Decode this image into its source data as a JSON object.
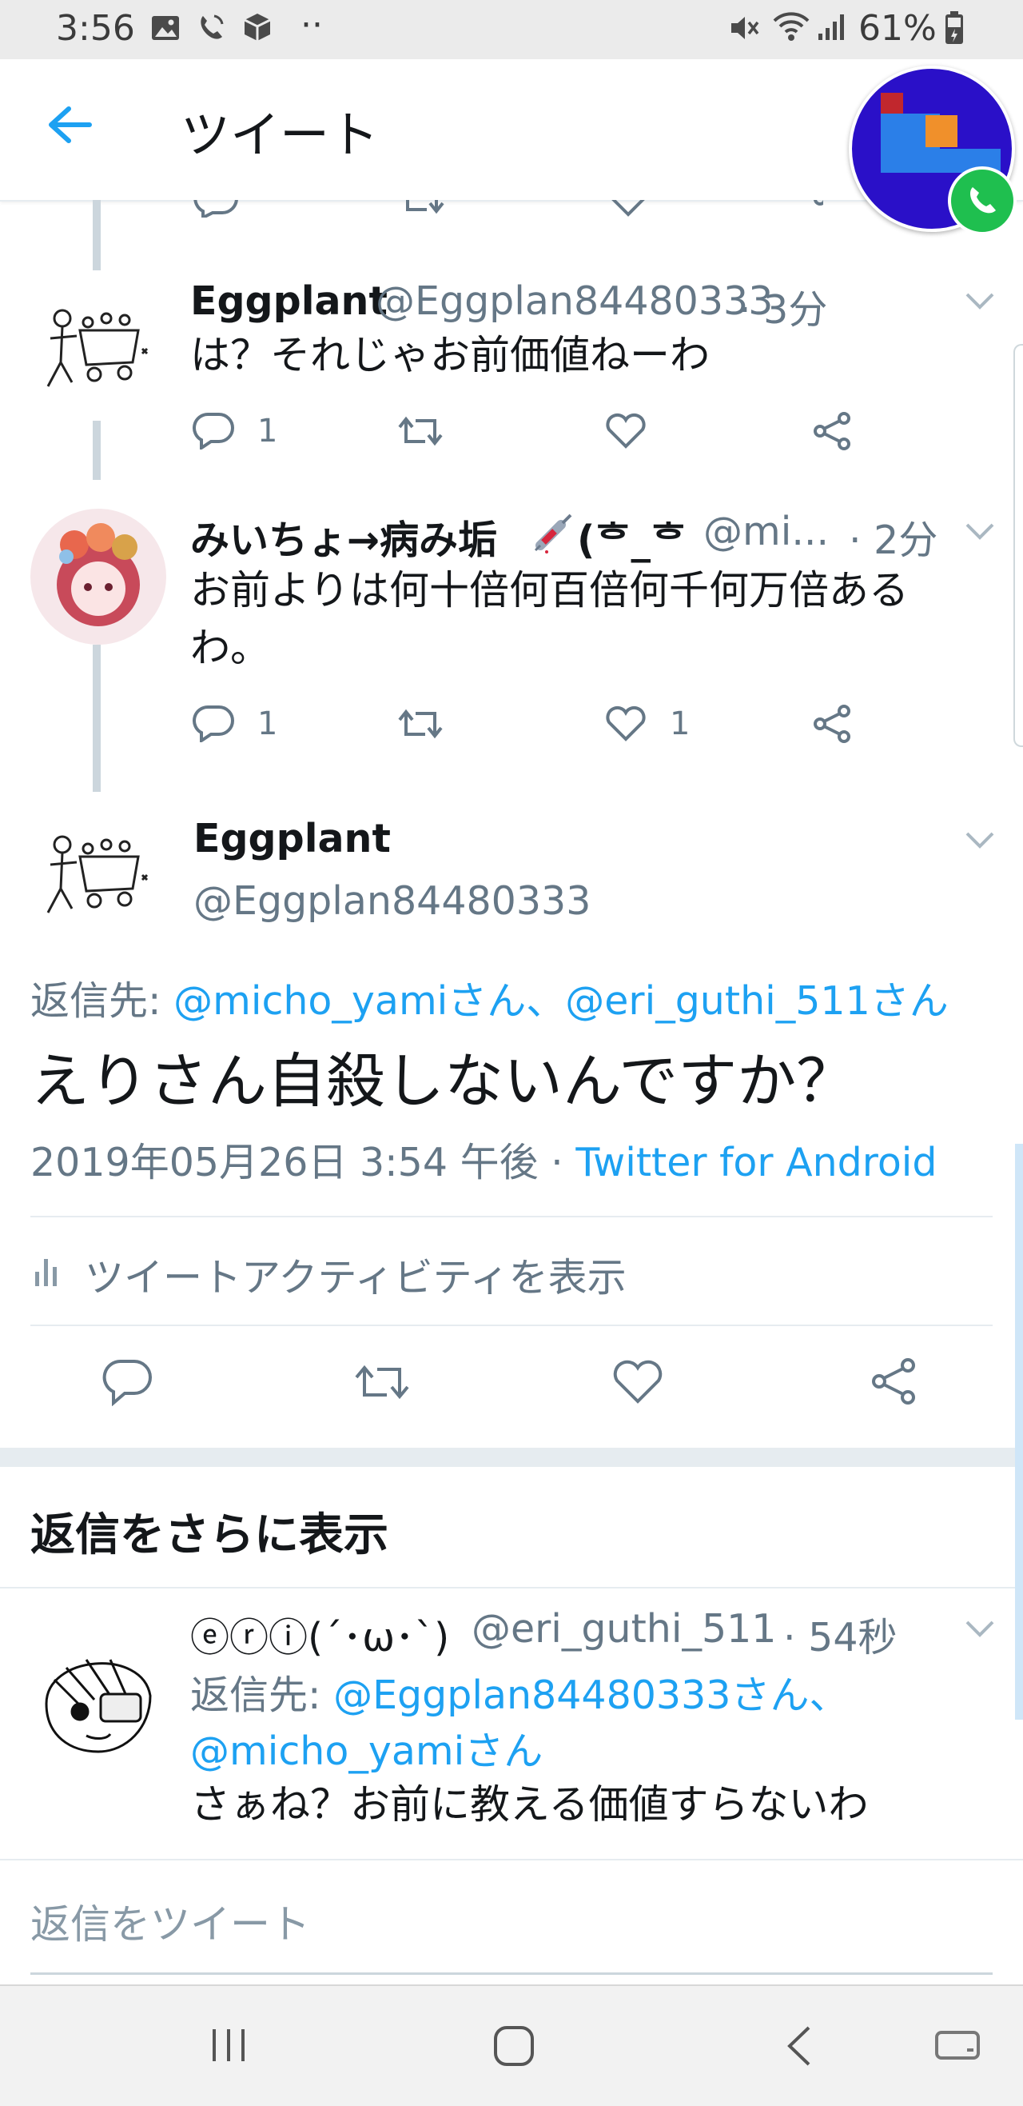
{
  "status_bar": {
    "time": "3:56",
    "more": "··",
    "battery": "61%"
  },
  "header": {
    "title": "ツイート"
  },
  "tweets": [
    {
      "name": "Eggplant",
      "handle": "@Eggplan84480333",
      "time": "· 3分",
      "text": "は？それじゃお前価値ねーわ",
      "reply_count": "1",
      "like_count": ""
    },
    {
      "name": "みいちょ→病み垢",
      "name_suffix": "(ᄒ_ᄒ",
      "handle": "@mi...",
      "time": "· 2分",
      "text_line1": "お前よりは何十倍何百倍何千何万倍ある",
      "text_line2": "わ。",
      "reply_count": "1",
      "like_count": "1"
    }
  ],
  "main_tweet": {
    "name": "Eggplant",
    "handle": "@Eggplan84480333",
    "reply_to_prefix": "返信先: ",
    "reply_to_links": "@micho_yamiさん、@eri_guthi_511さん",
    "text": "えりさん自殺しないんですか？",
    "timestamp": "2019年05月26日 3:54 午後 · ",
    "source": "Twitter for Android",
    "activity_label": "ツイートアクティビティを表示"
  },
  "more_replies": {
    "title": "返信をさらに表示"
  },
  "reply": {
    "name": "ⓔⓡⓘ(´･ω･`)",
    "handle": "@eri_guthi_511",
    "time": "· 54秒",
    "reply_to_prefix": "返信先: ",
    "reply_to_link1": "@Eggplan84480333さん、",
    "reply_to_link2": "@micho_yamiさん",
    "text": "さぁね？お前に教える価値すらないわ"
  },
  "compose": {
    "placeholder": "返信をツイート"
  },
  "colors": {
    "accent": "#1da1f2",
    "text": "#14171a",
    "secondary": "#657786",
    "call_green": "#1fbf4f",
    "chathead_bg": "#2a10c8"
  }
}
